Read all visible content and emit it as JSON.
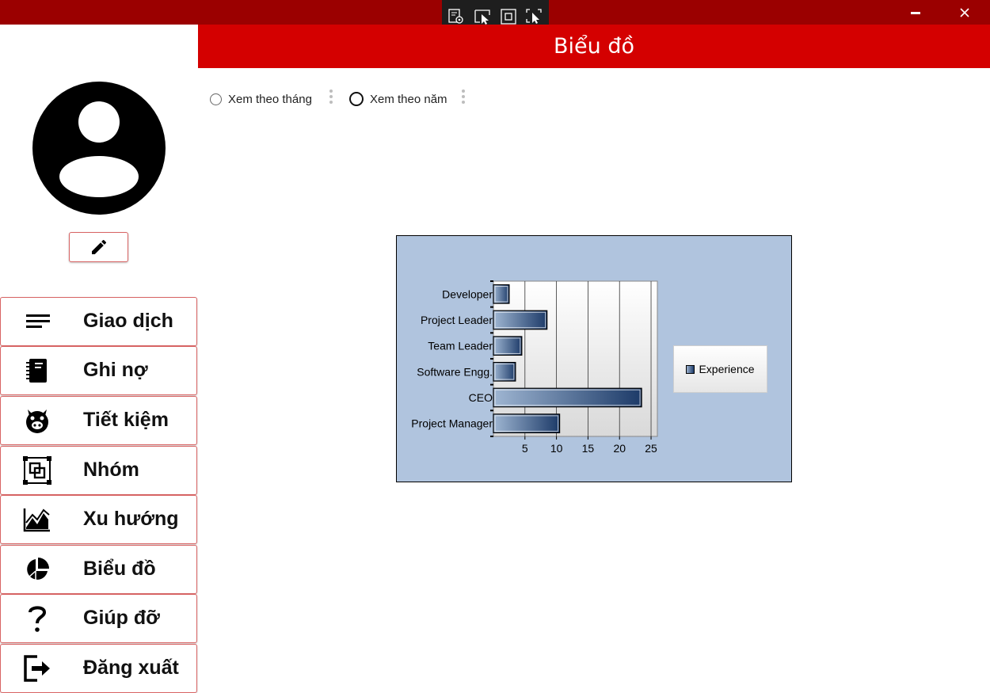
{
  "window": {
    "minimize_icon": "minimize-icon",
    "close_icon": "close-icon",
    "colors": {
      "titlebar": "#9b0000",
      "header": "#d40000",
      "nav_border": "#d86464",
      "chart_background": "#b0c4de"
    }
  },
  "debug_toolbar": {
    "icons": [
      "live-visual-tree-icon",
      "select-element-icon",
      "display-layout-adorners-icon",
      "track-focus-icon"
    ]
  },
  "header": {
    "title": "Biểu đồ"
  },
  "sidebar": {
    "avatar_icon": "user-avatar-icon",
    "edit_icon": "pencil-icon",
    "items": [
      {
        "label": "Giao dịch",
        "icon": "list-icon"
      },
      {
        "label": "Ghi nợ",
        "icon": "notebook-icon"
      },
      {
        "label": "Tiết kiệm",
        "icon": "piggy-icon"
      },
      {
        "label": "Nhóm",
        "icon": "group-icon"
      },
      {
        "label": "Xu hướng",
        "icon": "trend-icon"
      },
      {
        "label": "Biểu đồ",
        "icon": "pie-chart-icon"
      },
      {
        "label": "Giúp đỡ",
        "icon": "question-icon"
      },
      {
        "label": "Đăng xuất",
        "icon": "logout-icon"
      }
    ]
  },
  "filters": {
    "options": [
      {
        "label": "Xem theo tháng",
        "selected": false
      },
      {
        "label": "Xem theo năm",
        "selected": false
      }
    ]
  },
  "chart_data": {
    "type": "bar",
    "orientation": "horizontal",
    "categories": [
      "Developer",
      "Project Leader",
      "Team Leader",
      "Software Engg.",
      "CEO",
      "Project Manager"
    ],
    "series": [
      {
        "name": "Experience",
        "values": [
          2.5,
          8.5,
          4.5,
          3.5,
          23.5,
          10.5
        ]
      }
    ],
    "x_ticks": [
      5,
      10,
      15,
      20,
      25
    ],
    "xlim": [
      0,
      26
    ],
    "grid": true,
    "legend_position": "right",
    "title": "",
    "xlabel": "",
    "ylabel": ""
  }
}
